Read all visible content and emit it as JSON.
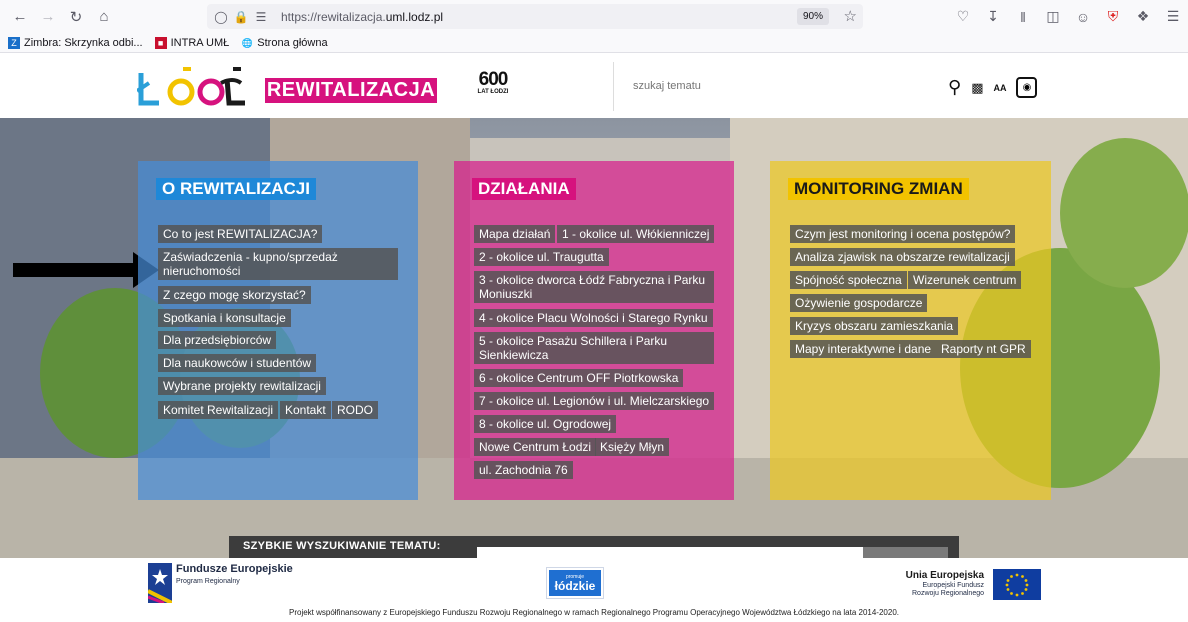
{
  "browser": {
    "url_prefix": "https://rewitalizacja.",
    "url_domain": "uml.lodz.pl",
    "zoom": "90%",
    "bookmarks": [
      "Zimbra: Skrzynka odbi...",
      "INTRA UMŁ",
      "Strona główna"
    ]
  },
  "header": {
    "badge": "REWITALIZACJA",
    "anniv_number": "600",
    "anniv_line": "LAT ŁODZI",
    "search_placeholder": "szukaj tematu",
    "font_size_label": "AA"
  },
  "panels": {
    "o_rewitalizacji": {
      "title": "O REWITALIZACJI",
      "links": [
        "Co to jest REWITALIZACJA?",
        "Zaświadczenia - kupno/sprzedaż nieruchomości",
        "Z czego mogę skorzystać?",
        "Spotkania i konsultacje",
        "Dla przedsiębiorców",
        "Dla naukowców i studentów",
        "Wybrane projekty rewitalizacji",
        "Komitet Rewitalizacji",
        "Kontakt",
        "RODO"
      ]
    },
    "dzialania": {
      "title": "DZIAŁANIA",
      "links": [
        "Mapa działań",
        "1 - okolice ul. Włókienniczej",
        "2 - okolice ul. Traugutta",
        "3 - okolice dworca Łódź Fabryczna i Parku Moniuszki",
        "4 - okolice Placu Wolności i Starego Rynku",
        "5 - okolice Pasażu Schillera i Parku Sienkiewicza",
        "6 - okolice Centrum OFF Piotrkowska",
        "7 - okolice ul. Legionów i ul. Mielczarskiego",
        "8 - okolice ul. Ogrodowej",
        "Nowe Centrum Łodzi",
        "Księży Młyn",
        "ul. Zachodnia 76"
      ]
    },
    "monitoring": {
      "title": "MONITORING ZMIAN",
      "links": [
        "Czym jest monitoring i ocena postępów?",
        "Analiza zjawisk na obszarze rewitalizacji",
        "Spójność społeczna",
        "Wizerunek centrum",
        "Ożywienie gospodarcze",
        "Kryzys obszaru zamieszkania",
        "Mapy interaktywne i dane",
        "Raporty nt GPR"
      ]
    }
  },
  "quick_search": {
    "label": "SZYBKIE WYSZUKIWANIE TEMATU:"
  },
  "footer": {
    "fe_title": "Fundusze Europejskie",
    "fe_sub": "Program Regionalny",
    "lodzkie_small": "promuje",
    "lodzkie_name": "łódzkie",
    "ue_title": "Unia Europejska",
    "ue_line1": "Europejski Fundusz",
    "ue_line2": "Rozwoju Regionalnego",
    "note": "Projekt współfinansowany z Europejskiego Funduszu Rozwoju Regionalnego w ramach Regionalnego Programu Operacyjnego Województwa Łódzkiego na lata 2014-2020."
  },
  "colors": {
    "blue": "#1e88d8",
    "pink": "#d6127e",
    "yellow": "#f2c300"
  }
}
